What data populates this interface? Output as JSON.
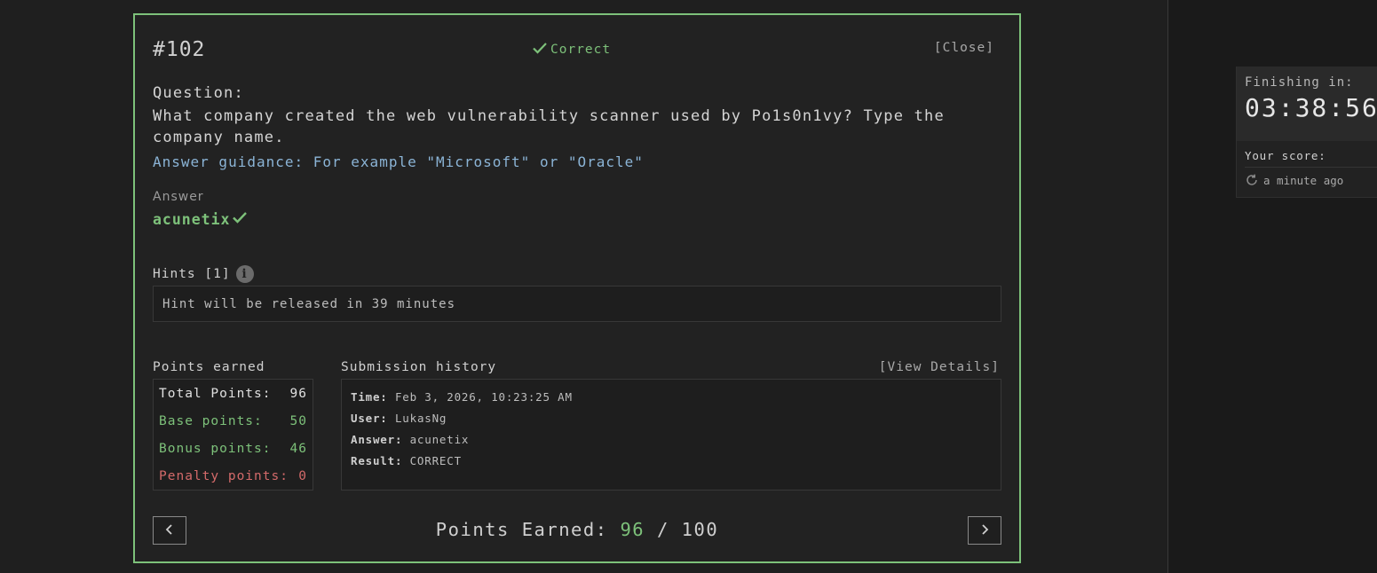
{
  "modal": {
    "question_number": "#102",
    "status": "Correct",
    "close_label": "[Close]",
    "question_label": "Question:",
    "question_text": "What company created the web vulnerability scanner used by Po1s0n1vy? Type the company name.",
    "answer_guidance": "Answer guidance: For example \"Microsoft\" or \"Oracle\"",
    "answer_label": "Answer",
    "answer_value": "acunetix",
    "hints_label": "Hints [1]",
    "hint_text": "Hint will be released in 39 minutes"
  },
  "points_earned": {
    "label": "Points earned",
    "total_label": "Total Points:",
    "total_value": "96",
    "base_label": "Base points:",
    "base_value": "50",
    "bonus_label": "Bonus points:",
    "bonus_value": "46",
    "penalty_label": "Penalty points:",
    "penalty_value": "0"
  },
  "submission_history": {
    "label": "Submission history",
    "view_details_label": "[View Details]",
    "time_label": "Time:",
    "time_value": "Feb 3, 2026, 10:23:25 AM",
    "user_label": "User:",
    "user_value": "LukasNg",
    "answer_label": "Answer:",
    "answer_value": "acunetix",
    "result_label": "Result:",
    "result_value": "CORRECT"
  },
  "footer": {
    "points_label": "Points Earned:",
    "earned": "96",
    "separator": "/",
    "possible": "100"
  },
  "sidebar": {
    "finishing_label": "Finishing in:",
    "countdown": "03:38:56",
    "score_label": "Your score:",
    "updated": "a minute ago"
  },
  "colors": {
    "accent_green": "#7dc17a",
    "penalty_red": "#d46a6a",
    "guidance_blue": "#8bb4d6",
    "background": "#1f1f1f"
  },
  "icons": [
    "check-icon",
    "info-icon",
    "refresh-icon",
    "chevron-left-icon",
    "chevron-right-icon"
  ]
}
